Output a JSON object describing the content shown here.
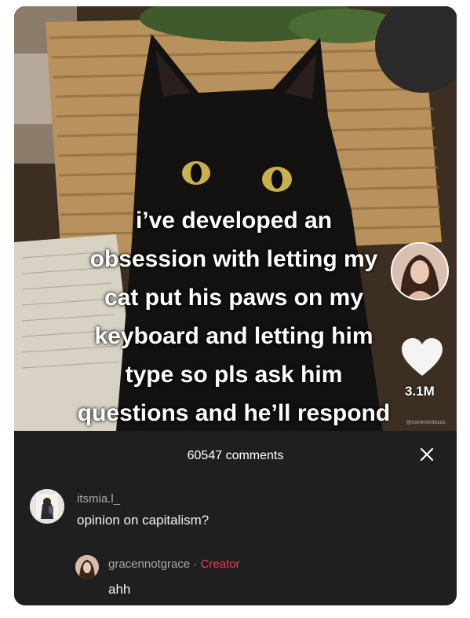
{
  "video": {
    "caption_lines": [
      "i’ve developed an",
      "obsession with letting my",
      "cat put his paws on my",
      "keyboard and letting him",
      "type so pls ask him",
      "questions and he’ll respond"
    ],
    "like_count": "3.1M",
    "heart_icon": "heart-icon",
    "watermark": "@commentsxoc"
  },
  "comments": {
    "title": "60547 comments",
    "close_icon": "close-icon",
    "items": [
      {
        "username": "itsmia.l_",
        "text": "opinion on capitalism?",
        "reply": {
          "username": "gracennotgrace",
          "separator": "·",
          "badge": "Creator",
          "text": "ahh"
        }
      }
    ]
  },
  "colors": {
    "sheet_bg": "#1f1f1f",
    "creator_badge": "#f0395a",
    "username": "#a9a9a9",
    "text": "#f2f2f2"
  }
}
